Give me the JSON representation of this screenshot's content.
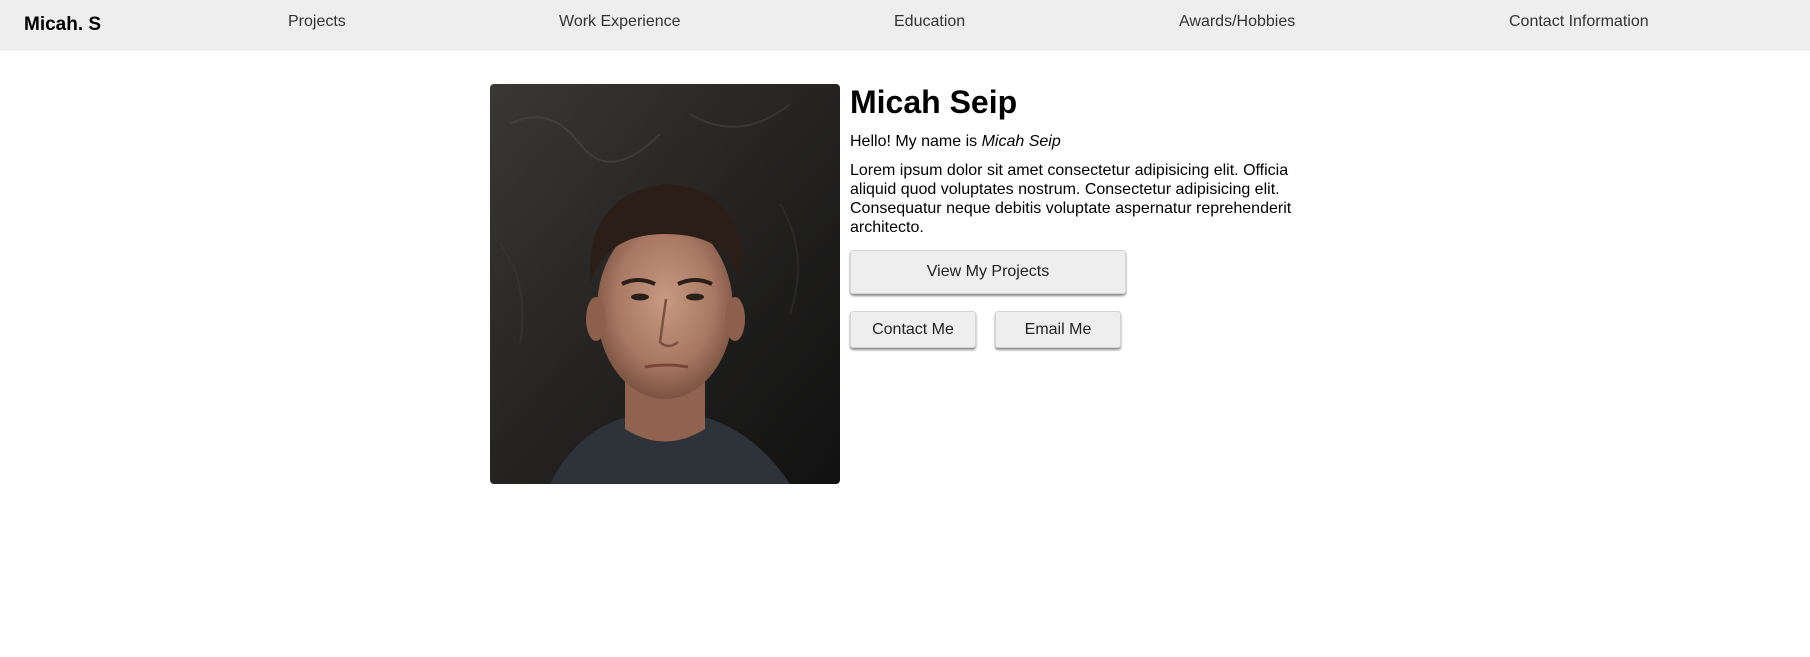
{
  "nav": {
    "brand": "Micah. S",
    "links": [
      "Projects",
      "Work Experience",
      "Education",
      "Awards/Hobbies",
      "Contact Information"
    ]
  },
  "profile": {
    "photo_icon": "portrait-photo",
    "name": "Micah Seip",
    "hello_prefix": "Hello! My name is ",
    "hello_name": "Micah Seip",
    "bio": "Lorem ipsum dolor sit amet consectetur adipisicing elit. Officia aliquid quod voluptates nostrum. Consectetur adipisicing elit. Consequatur neque debitis voluptate aspernatur reprehenderit architecto."
  },
  "buttons": {
    "view_projects": "View My Projects",
    "contact_me": "Contact Me",
    "email_me": "Email Me"
  }
}
